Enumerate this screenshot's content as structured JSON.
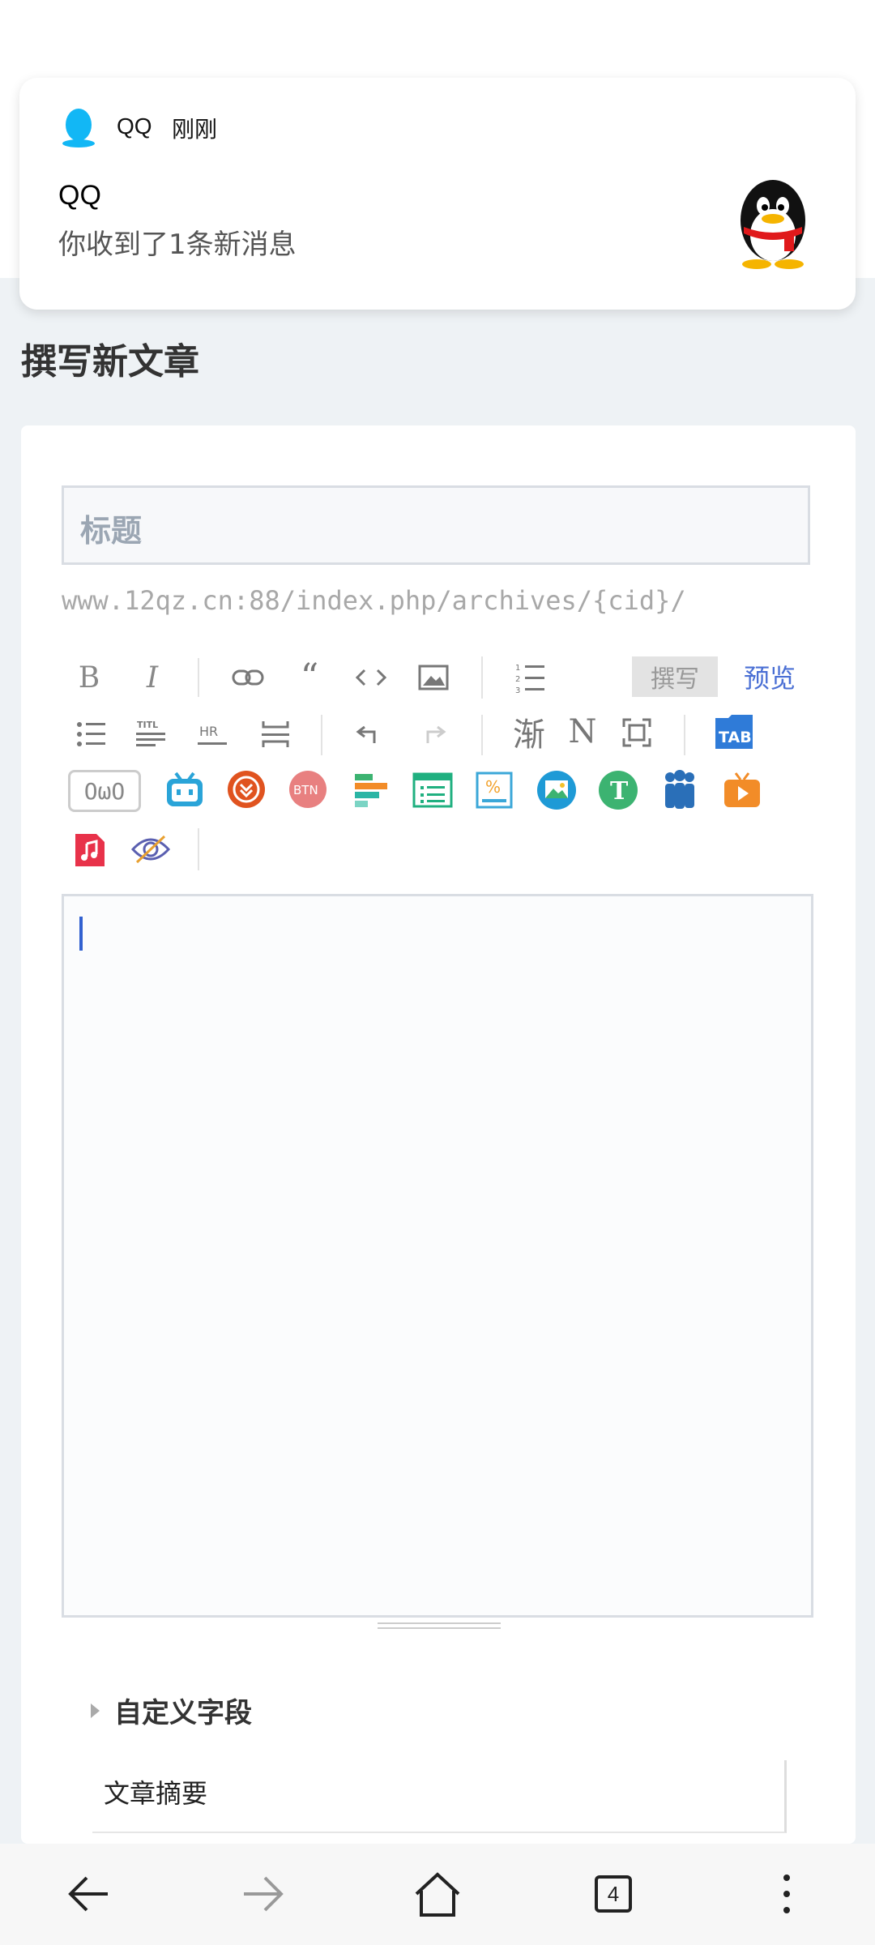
{
  "notification": {
    "app_name": "QQ",
    "time": "刚刚",
    "title": "QQ",
    "message": "你收到了1条新消息"
  },
  "page": {
    "title": "撰写新文章",
    "title_placeholder": "标题",
    "permalink": "www.12qz.cn:88/index.php/archives/{cid}/"
  },
  "toolbar": {
    "write_tab": "撰写",
    "preview_tab": "预览",
    "gradient_label": "渐",
    "normal_label": "N",
    "owo_label": "OωO",
    "tab_label": "TAB",
    "title_label": "TITL",
    "hr_label": "HR",
    "btn_label": "BTN",
    "t_label": "T"
  },
  "fields": {
    "custom_fields": "自定义字段",
    "summary": "文章摘要"
  },
  "bottom_nav": {
    "tabs_count": "4"
  },
  "colors": {
    "accent": "#4a6fd4",
    "caret": "#3261d0",
    "page_bg": "#eef2f5"
  }
}
